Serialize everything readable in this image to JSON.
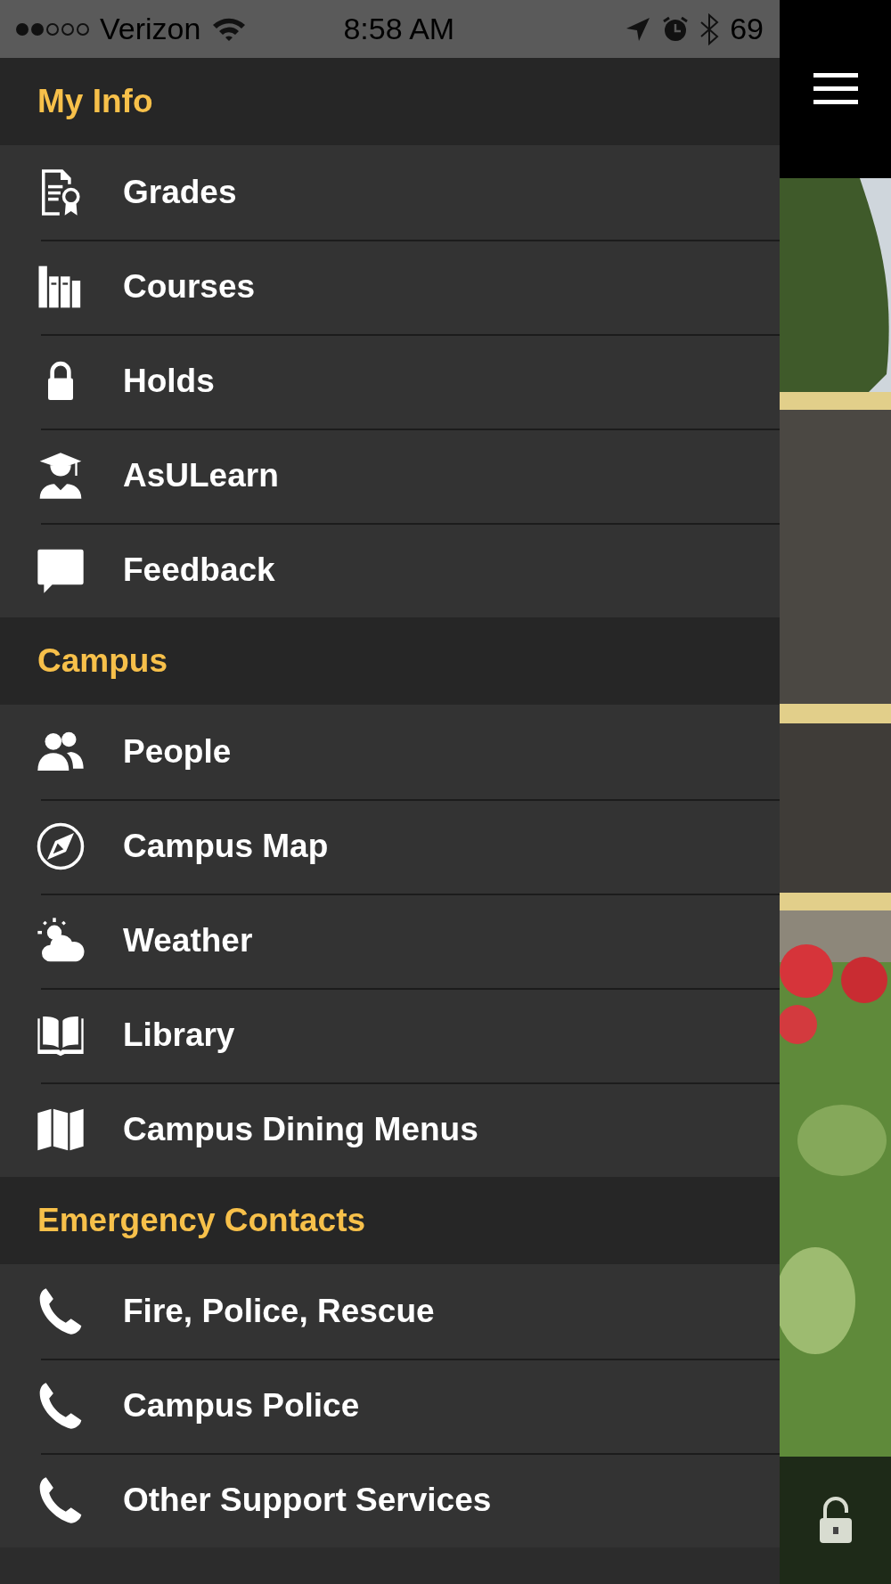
{
  "status_bar": {
    "carrier": "Verizon",
    "time": "8:58 AM",
    "battery": "69"
  },
  "sections": [
    {
      "title": "My Info",
      "items": [
        {
          "label": "Grades",
          "kind": "grades"
        },
        {
          "label": "Courses",
          "kind": "books"
        },
        {
          "label": "Holds",
          "kind": "lock"
        },
        {
          "label": "AsULearn",
          "kind": "graduate"
        },
        {
          "label": "Feedback",
          "kind": "speech"
        }
      ]
    },
    {
      "title": "Campus",
      "items": [
        {
          "label": "People",
          "kind": "people"
        },
        {
          "label": "Campus Map",
          "kind": "compass"
        },
        {
          "label": "Weather",
          "kind": "weather"
        },
        {
          "label": "Library",
          "kind": "book"
        },
        {
          "label": "Campus Dining Menus",
          "kind": "map"
        }
      ]
    },
    {
      "title": "Emergency Contacts",
      "items": [
        {
          "label": "Fire, Police, Rescue",
          "kind": "phone"
        },
        {
          "label": "Campus Police",
          "kind": "phone"
        },
        {
          "label": "Other Support Services",
          "kind": "phone"
        }
      ]
    }
  ]
}
